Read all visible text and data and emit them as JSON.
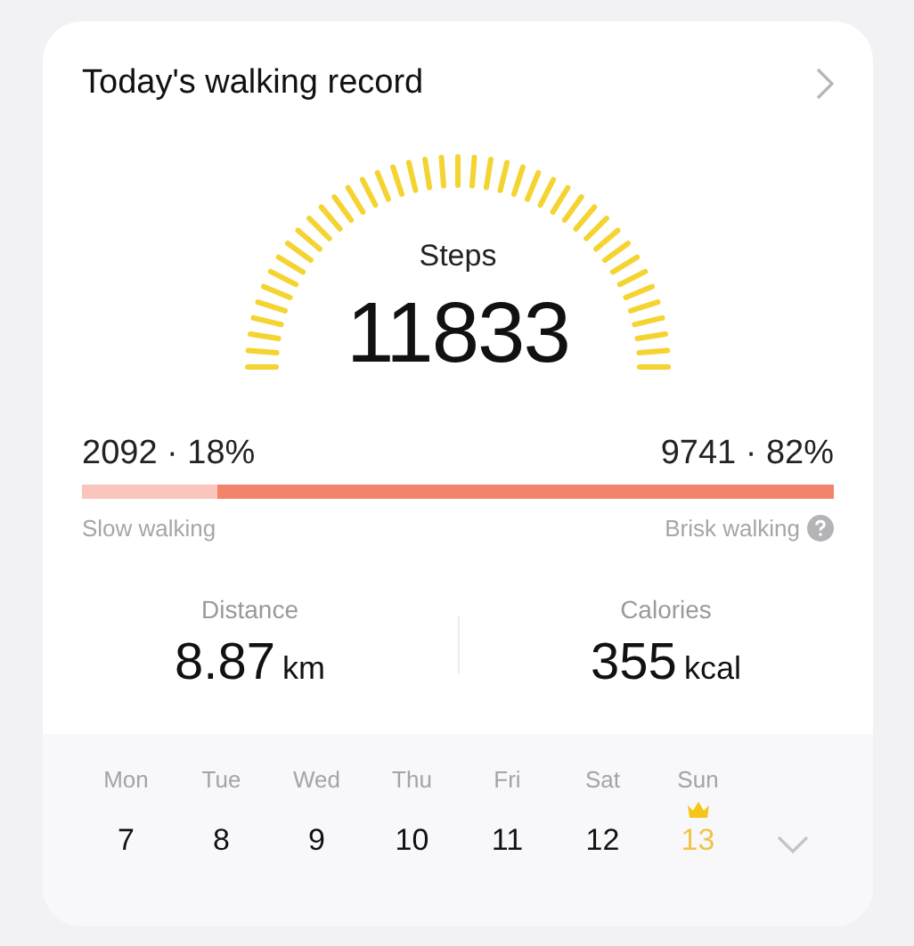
{
  "title": "Today's walking record",
  "steps": {
    "label": "Steps",
    "value": "11833"
  },
  "split": {
    "slow": {
      "count": "2092",
      "percent": "18%",
      "label": "Slow walking",
      "level": 0.18
    },
    "brisk": {
      "count": "9741",
      "percent": "82%",
      "label": "Brisk walking"
    },
    "separator": "·"
  },
  "stats": [
    {
      "label": "Distance",
      "value": "8.87",
      "unit": "km"
    },
    {
      "label": "Calories",
      "value": "355",
      "unit": "kcal"
    }
  ],
  "days": [
    {
      "weekday": "Mon",
      "date": "7",
      "selected": false,
      "crown": false
    },
    {
      "weekday": "Tue",
      "date": "8",
      "selected": false,
      "crown": false
    },
    {
      "weekday": "Wed",
      "date": "9",
      "selected": false,
      "crown": false
    },
    {
      "weekday": "Thu",
      "date": "10",
      "selected": false,
      "crown": false
    },
    {
      "weekday": "Fri",
      "date": "11",
      "selected": false,
      "crown": false
    },
    {
      "weekday": "Sat",
      "date": "12",
      "selected": false,
      "crown": false
    },
    {
      "weekday": "Sun",
      "date": "13",
      "selected": true,
      "crown": true
    }
  ]
}
